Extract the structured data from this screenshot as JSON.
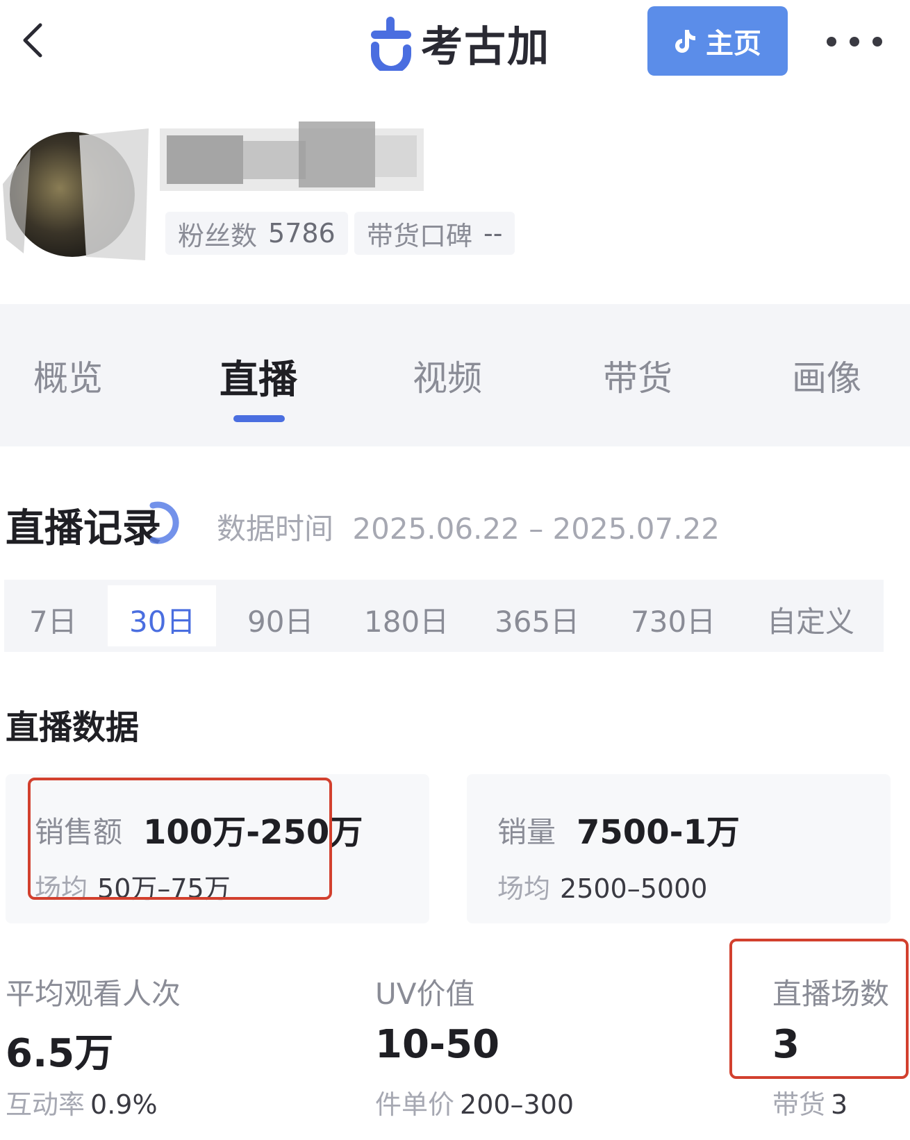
{
  "header": {
    "logo_text": "考古加",
    "home_label": "主页",
    "home_icon": "douyin-icon",
    "more_icon": "more-dots-icon",
    "back_icon": "chevron-left-icon"
  },
  "profile": {
    "fans_label": "粉丝数",
    "fans_value": "5786",
    "reputation_label": "带货口碑",
    "reputation_value": "--"
  },
  "tabs": [
    {
      "label": "概览"
    },
    {
      "label": "直播"
    },
    {
      "label": "视频"
    },
    {
      "label": "带货"
    },
    {
      "label": "画像"
    }
  ],
  "active_tab": "直播",
  "live_record": {
    "title": "直播记录",
    "time_label": "数据时间",
    "time_range": "2025.06.22 – 2025.07.22"
  },
  "ranges": [
    {
      "label": "7日"
    },
    {
      "label": "30日"
    },
    {
      "label": "90日"
    },
    {
      "label": "180日"
    },
    {
      "label": "365日"
    },
    {
      "label": "730日"
    },
    {
      "label": "自定义"
    }
  ],
  "active_range": "30日",
  "live_data": {
    "title": "直播数据",
    "sales_amount": {
      "label": "销售额",
      "value": "100万-250万",
      "avg_label": "场均",
      "avg_value": "50万–75万"
    },
    "sales_volume": {
      "label": "销量",
      "value": "7500-1万",
      "avg_label": "场均",
      "avg_value": "2500–5000"
    }
  },
  "metrics": [
    {
      "label": "平均观看人次",
      "value": "6.5万",
      "sub_label": "互动率",
      "sub_value": "0.9%"
    },
    {
      "label": "UV价值",
      "value": "10-50",
      "sub_label": "件单价",
      "sub_value": "200–300"
    },
    {
      "label": "直播场数",
      "value": "3",
      "sub_label": "带货",
      "sub_value": "3"
    }
  ],
  "colors": {
    "accent": "#4a6ee0",
    "home_button": "#5b8de9",
    "highlight_box": "#d2402e"
  }
}
